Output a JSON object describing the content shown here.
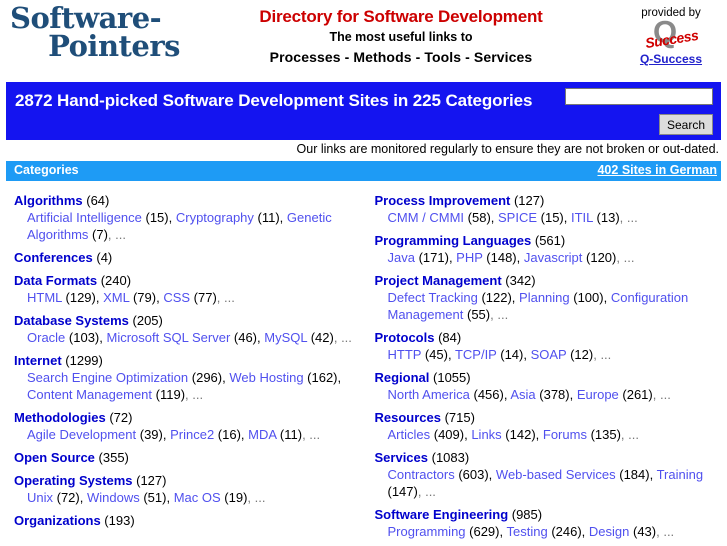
{
  "header": {
    "logo_line1": "Software-",
    "logo_line2": "Pointers",
    "tagline_main": "Directory for Software Development",
    "tagline_sub1": "The most useful links to",
    "tagline_sub2": "Processes - Methods - Tools - Services",
    "provider_label": "provided by",
    "provider_logo_letter": "Q",
    "provider_logo_word": "Success",
    "provider_link": "Q-Success"
  },
  "banner": {
    "title": "2872 Hand-picked Software Development Sites in 225 Categories",
    "search_value": "",
    "search_placeholder": "",
    "search_button": "Search"
  },
  "note": "Our links are monitored regularly to ensure they are not broken or out-dated.",
  "categories_bar": {
    "title": "Categories",
    "german_link": "402 Sites in German"
  },
  "columns": {
    "left": [
      {
        "name": "Algorithms",
        "count": "(64)",
        "subs": [
          {
            "name": "Artificial Intelligence",
            "count": "(15)"
          },
          {
            "name": "Cryptography",
            "count": "(11)"
          },
          {
            "name": "Genetic Algorithms",
            "count": "(7)"
          }
        ],
        "more": "..."
      },
      {
        "name": "Conferences",
        "count": "(4)",
        "subs": [],
        "more": ""
      },
      {
        "name": "Data Formats",
        "count": "(240)",
        "subs": [
          {
            "name": "HTML",
            "count": "(129)"
          },
          {
            "name": "XML",
            "count": "(79)"
          },
          {
            "name": "CSS",
            "count": "(77)"
          }
        ],
        "more": "..."
      },
      {
        "name": "Database Systems",
        "count": "(205)",
        "subs": [
          {
            "name": "Oracle",
            "count": "(103)"
          },
          {
            "name": "Microsoft SQL Server",
            "count": "(46)"
          },
          {
            "name": "MySQL",
            "count": "(42)"
          }
        ],
        "more": "..."
      },
      {
        "name": "Internet",
        "count": "(1299)",
        "subs": [
          {
            "name": "Search Engine Optimization",
            "count": "(296)"
          },
          {
            "name": "Web Hosting",
            "count": "(162)"
          },
          {
            "name": "Content Management",
            "count": "(119)"
          }
        ],
        "more": "..."
      },
      {
        "name": "Methodologies",
        "count": "(72)",
        "subs": [
          {
            "name": "Agile Development",
            "count": "(39)"
          },
          {
            "name": "Prince2",
            "count": "(16)"
          },
          {
            "name": "MDA",
            "count": "(11)"
          }
        ],
        "more": "..."
      },
      {
        "name": "Open Source",
        "count": "(355)",
        "subs": [],
        "more": ""
      },
      {
        "name": "Operating Systems",
        "count": "(127)",
        "subs": [
          {
            "name": "Unix",
            "count": "(72)"
          },
          {
            "name": "Windows",
            "count": "(51)"
          },
          {
            "name": "Mac OS",
            "count": "(19)"
          }
        ],
        "more": "..."
      },
      {
        "name": "Organizations",
        "count": "(193)",
        "subs": [],
        "more": ""
      }
    ],
    "right": [
      {
        "name": "Process Improvement",
        "count": "(127)",
        "subs": [
          {
            "name": "CMM / CMMI",
            "count": "(58)"
          },
          {
            "name": "SPICE",
            "count": "(15)"
          },
          {
            "name": "ITIL",
            "count": "(13)"
          }
        ],
        "more": "..."
      },
      {
        "name": "Programming Languages",
        "count": "(561)",
        "subs": [
          {
            "name": "Java",
            "count": "(171)"
          },
          {
            "name": "PHP",
            "count": "(148)"
          },
          {
            "name": "Javascript",
            "count": "(120)"
          }
        ],
        "more": "..."
      },
      {
        "name": "Project Management",
        "count": "(342)",
        "subs": [
          {
            "name": "Defect Tracking",
            "count": "(122)"
          },
          {
            "name": "Planning",
            "count": "(100)"
          },
          {
            "name": "Configuration Management",
            "count": "(55)"
          }
        ],
        "more": "..."
      },
      {
        "name": "Protocols",
        "count": "(84)",
        "subs": [
          {
            "name": "HTTP",
            "count": "(45)"
          },
          {
            "name": "TCP/IP",
            "count": "(14)"
          },
          {
            "name": "SOAP",
            "count": "(12)"
          }
        ],
        "more": "..."
      },
      {
        "name": "Regional",
        "count": "(1055)",
        "subs": [
          {
            "name": "North America",
            "count": "(456)"
          },
          {
            "name": "Asia",
            "count": "(378)"
          },
          {
            "name": "Europe",
            "count": "(261)"
          }
        ],
        "more": "..."
      },
      {
        "name": "Resources",
        "count": "(715)",
        "subs": [
          {
            "name": "Articles",
            "count": "(409)"
          },
          {
            "name": "Links",
            "count": "(142)"
          },
          {
            "name": "Forums",
            "count": "(135)"
          }
        ],
        "more": "..."
      },
      {
        "name": "Services",
        "count": "(1083)",
        "subs": [
          {
            "name": "Contractors",
            "count": "(603)"
          },
          {
            "name": "Web-based Services",
            "count": "(184)"
          },
          {
            "name": "Training",
            "count": "(147)"
          }
        ],
        "more": "..."
      },
      {
        "name": "Software Engineering",
        "count": "(985)",
        "subs": [
          {
            "name": "Programming",
            "count": "(629)"
          },
          {
            "name": "Testing",
            "count": "(246)"
          },
          {
            "name": "Design",
            "count": "(43)"
          }
        ],
        "more": "..."
      }
    ]
  }
}
